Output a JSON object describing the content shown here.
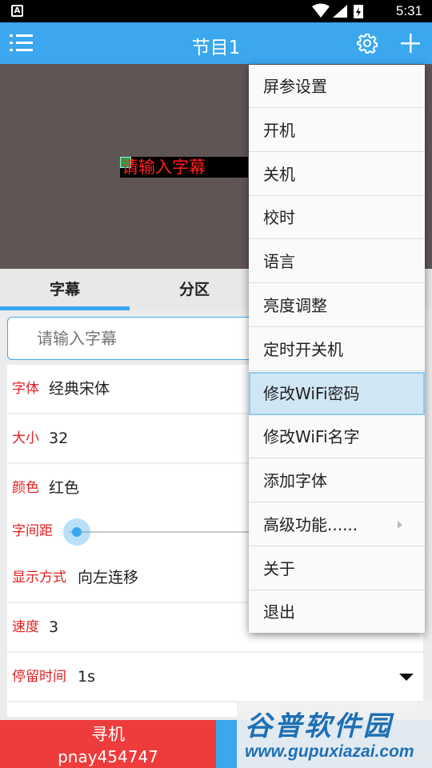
{
  "statusbar": {
    "time": "5:31",
    "app_icon": "A"
  },
  "appbar": {
    "title": "节目1"
  },
  "preview": {
    "text": "请输入字幕"
  },
  "tabs": [
    {
      "label": "字幕",
      "active": true
    },
    {
      "label": "分区",
      "active": false
    }
  ],
  "subtitle_input": {
    "placeholder": "请输入字幕"
  },
  "settings": {
    "font": {
      "label": "字体",
      "value": "经典宋体"
    },
    "size": {
      "label": "大小",
      "value": "32"
    },
    "color": {
      "label": "颜色",
      "value": "红色"
    },
    "spacing": {
      "label": "字间距"
    },
    "display_mode": {
      "label": "显示方式",
      "value": "向左连移"
    },
    "speed": {
      "label": "速度",
      "value": "3"
    },
    "dwell": {
      "label": "停留时间",
      "value": "1s"
    }
  },
  "footer": {
    "search_label": "寻机",
    "device_id": "pnay454747"
  },
  "watermark": {
    "name": "谷普软件园",
    "url": "www.gupuxiazai.com"
  },
  "menu": {
    "items": [
      "屏参设置",
      "开机",
      "关机",
      "校时",
      "语言",
      "亮度调整",
      "定时开关机",
      "修改WiFi密码",
      "修改WiFi名字",
      "添加字体",
      "高级功能......",
      "关于",
      "退出"
    ],
    "highlighted_index": 7
  },
  "colors": {
    "accent": "#3aa7ee",
    "label_red": "#e02020",
    "footer_red": "#ee3b3b",
    "led_text": "#ff2020"
  }
}
